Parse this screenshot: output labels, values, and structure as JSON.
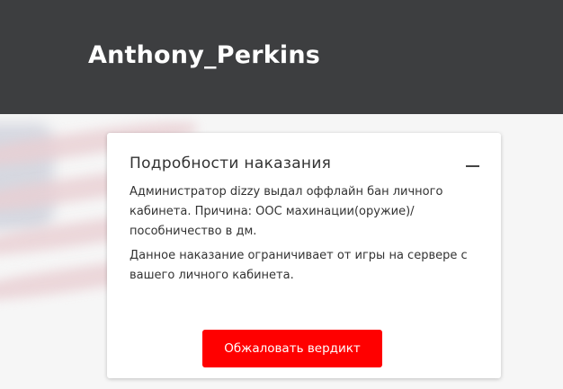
{
  "header": {
    "username": "Anthony_Perkins"
  },
  "punishment_card": {
    "title": "Подробности наказания",
    "collapse_icon": "minus-icon",
    "description": "Администратор dizzy выдал оффлайн бан личного кабинета. Причина: ООС махинации(оружие)/пособничество в дм.",
    "restriction_note": "Данное наказание ограничивает от игры на сервере с вашего личного кабинета.",
    "appeal_button_label": "Обжаловать вердикт"
  },
  "colors": {
    "header_bg": "#3d3e40",
    "accent": "#ff0000",
    "card_bg": "#ffffff"
  }
}
